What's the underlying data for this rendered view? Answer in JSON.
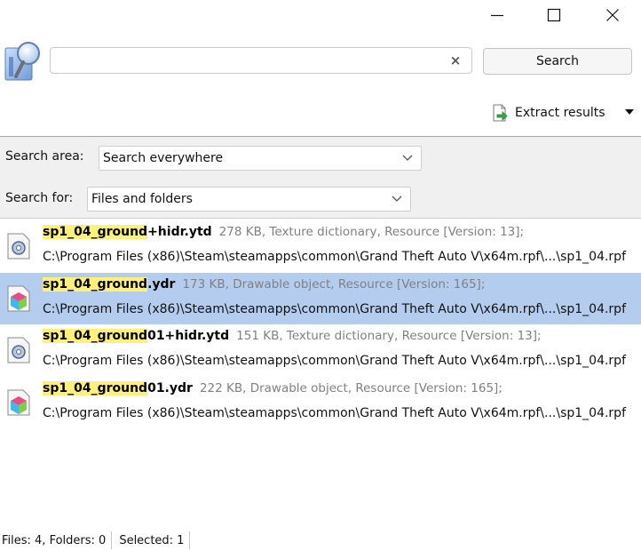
{
  "titlebar": {
    "minimize_icon": "minimize-icon",
    "maximize_icon": "maximize-icon",
    "close_icon": "close-icon"
  },
  "search": {
    "value": "",
    "placeholder": "",
    "clear_label": "×",
    "button_label": "Search"
  },
  "extract": {
    "label": "Extract results",
    "icon": "extract-icon"
  },
  "options": {
    "area_label": "Search area:",
    "area_value": "Search everywhere",
    "for_label": "Search for:",
    "for_value": "Files and folders"
  },
  "results": [
    {
      "name_highlight": "sp1_04_ground",
      "name_rest": "+hidr.ytd",
      "meta": "278 KB, Texture dictionary, Resource [Version: 13];",
      "path": "C:\\Program Files (x86)\\Steam\\steamapps\\common\\Grand Theft Auto V\\x64m.rpf\\...\\sp1_04.rpf",
      "icon": "texture-dictionary-icon",
      "selected": false
    },
    {
      "name_highlight": "sp1_04_ground",
      "name_rest": ".ydr",
      "meta": "173 KB, Drawable object, Resource [Version: 165];",
      "path": "C:\\Program Files (x86)\\Steam\\steamapps\\common\\Grand Theft Auto V\\x64m.rpf\\...\\sp1_04.rpf",
      "icon": "drawable-object-icon",
      "selected": true
    },
    {
      "name_highlight": "sp1_04_ground",
      "name_rest": "01+hidr.ytd",
      "meta": "151 KB, Texture dictionary, Resource [Version: 13];",
      "path": "C:\\Program Files (x86)\\Steam\\steamapps\\common\\Grand Theft Auto V\\x64m.rpf\\...\\sp1_04.rpf",
      "icon": "texture-dictionary-icon",
      "selected": false
    },
    {
      "name_highlight": "sp1_04_ground",
      "name_rest": "01.ydr",
      "meta": "222 KB, Drawable object, Resource [Version: 165];",
      "path": "C:\\Program Files (x86)\\Steam\\steamapps\\common\\Grand Theft Auto V\\x64m.rpf\\...\\sp1_04.rpf",
      "icon": "drawable-object-icon",
      "selected": false
    }
  ],
  "status": {
    "counts": "Files: 4, Folders: 0",
    "selected": "Selected: 1"
  }
}
